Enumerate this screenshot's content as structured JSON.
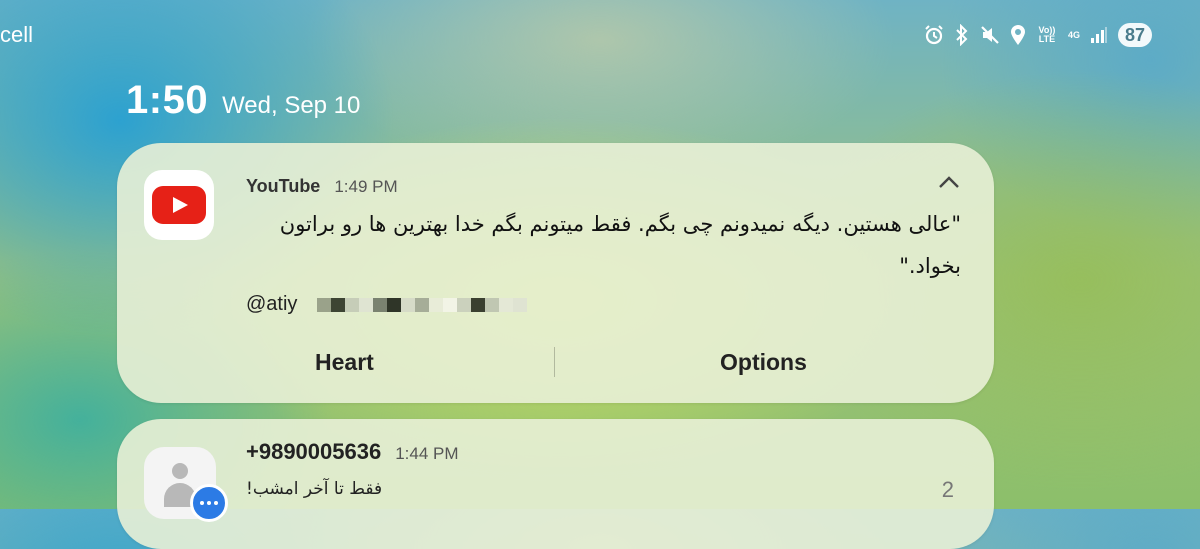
{
  "status_bar": {
    "carrier_fragment": "cell",
    "network_text": "Vo)) LTE",
    "network_type": "4G",
    "battery": "87",
    "icons": [
      "alarm-icon",
      "bluetooth-icon",
      "mute-icon",
      "location-icon",
      "volte-icon",
      "4g-icon",
      "signal-icon",
      "battery-icon"
    ]
  },
  "lockscreen": {
    "time": "1:50",
    "date": "Wed, Sep 10"
  },
  "notifications": [
    {
      "app": "YouTube",
      "time": "1:49 PM",
      "icon": "youtube-icon",
      "message": "\"عالی هستین. دیگه نمیدونم چی بگم. فقط میتونم بگم خدا بهترین ها رو براتون بخواد.\"",
      "handle": "@atiy",
      "actions": [
        "Heart",
        "Options"
      ]
    },
    {
      "sender": "+9890005636",
      "time": "1:44 PM",
      "icon": "contact-avatar-icon",
      "message": "فقط تا آخر امشب!",
      "count": "2"
    }
  ],
  "colors": {
    "youtube_red": "#e62117",
    "messages_blue": "#2c7be5"
  }
}
